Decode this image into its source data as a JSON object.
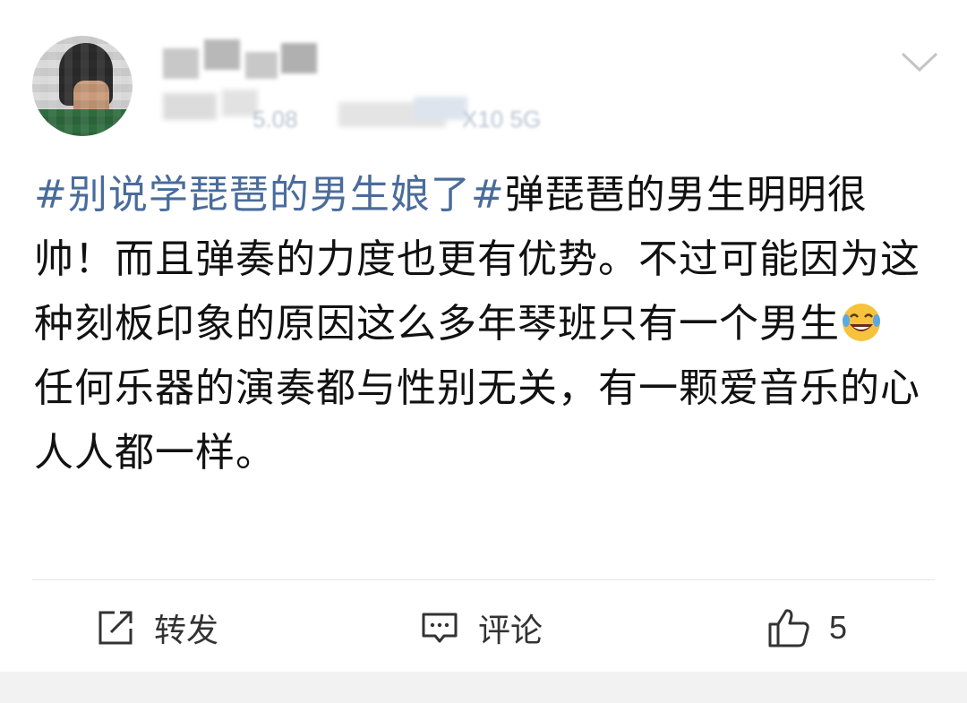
{
  "post": {
    "topic": "#别说学琵琶的男生娘了#",
    "text_before_emoji": "弹琵琶的男生明明很帅！而且弹奏的力度也更有优势。不过可能因为这种刻板印象的原因这么多年琴班只有一个男生",
    "emoji": "laughing-crying-emoji",
    "text_after_emoji": " 任何乐器的演奏都与性别无关，有一颗爱音乐的心人人都一样。"
  },
  "header": {
    "meta_fragment_1": "5.08",
    "meta_fragment_2": "X10 5G"
  },
  "actions": {
    "repost_label": "转发",
    "comment_label": "评论",
    "like_count": "5"
  },
  "colors": {
    "topic": "#4a6c9b",
    "text": "#111111",
    "icon": "#333333"
  }
}
